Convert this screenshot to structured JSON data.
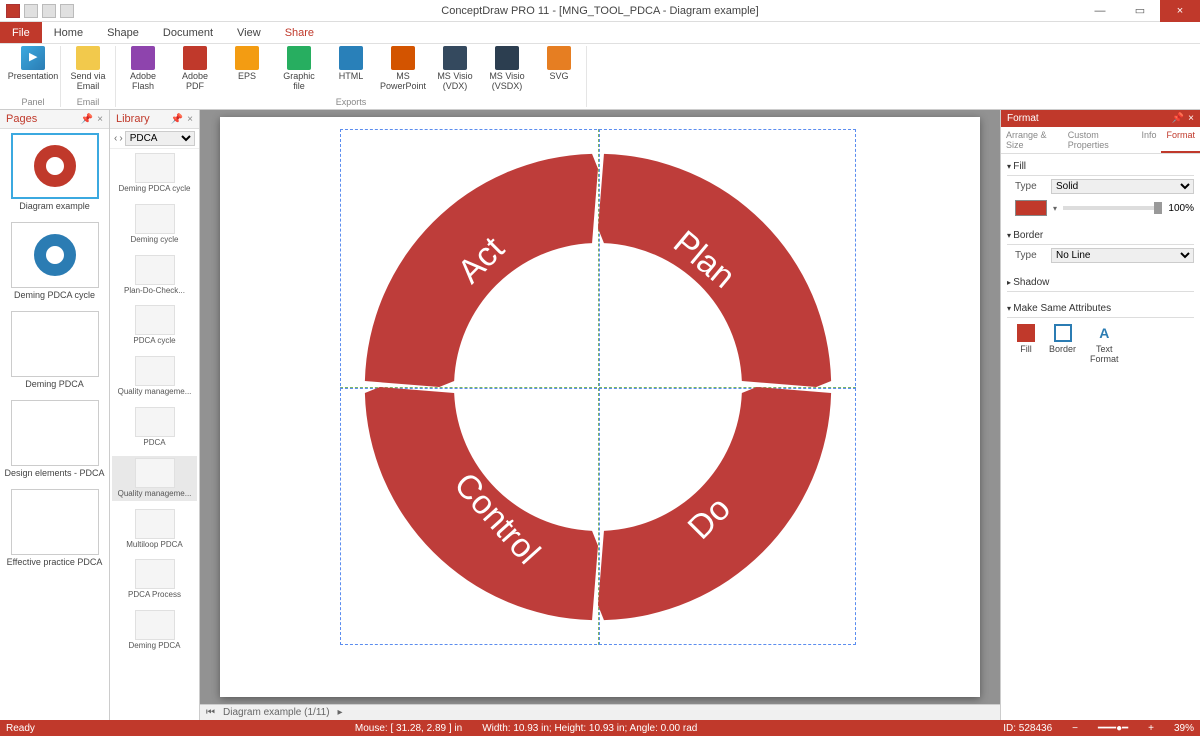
{
  "app": {
    "title": "ConceptDraw PRO 11 - [MNG_TOOL_PDCA - Diagram example]"
  },
  "window": {
    "min": "—",
    "max": "▭",
    "close": "×"
  },
  "tabs": {
    "file": "File",
    "home": "Home",
    "shape": "Shape",
    "document": "Document",
    "view": "View",
    "share": "Share"
  },
  "ribbon": {
    "panel_label": "Panel",
    "email_label": "Email",
    "exports_label": "Exports",
    "presentation": "Presentation",
    "send_email": "Send via\nEmail",
    "flash": "Adobe\nFlash",
    "pdf": "Adobe\nPDF",
    "eps": "EPS",
    "gfx": "Graphic\nfile",
    "html": "HTML",
    "ppt": "MS\nPowerPoint",
    "vdx": "MS Visio\n(VDX)",
    "vsdx": "MS Visio\n(VSDX)",
    "svg": "SVG"
  },
  "pages_panel": {
    "title": "Pages",
    "items": [
      "Diagram example",
      "Deming PDCA cycle",
      "Deming PDCA",
      "Design elements - PDCA",
      "Effective practice PDCA"
    ]
  },
  "library_panel": {
    "title": "Library",
    "dropdown": "PDCA",
    "items": [
      "Deming PDCA cycle",
      "Deming cycle",
      "Plan-Do-Check...",
      "PDCA cycle",
      "Quality manageme...",
      "PDCA",
      "Quality manageme...",
      "Multiloop PDCA",
      "PDCA Process",
      "Deming PDCA"
    ]
  },
  "diagram": {
    "segments": {
      "act": "Act",
      "plan": "Plan",
      "do": "Do",
      "control": "Control"
    },
    "color": "#BE3D3A"
  },
  "canvas_tabs": {
    "label": "Diagram example (1/11)"
  },
  "format_panel": {
    "title": "Format",
    "tabs": {
      "arrange": "Arrange & Size",
      "custom": "Custom Properties",
      "info": "Info",
      "format": "Format"
    },
    "fill": {
      "header": "Fill",
      "type_label": "Type",
      "type_value": "Solid",
      "opacity": "100%"
    },
    "border": {
      "header": "Border",
      "type_label": "Type",
      "type_value": "No Line"
    },
    "shadow": {
      "header": "Shadow"
    },
    "msa": {
      "header": "Make Same Attributes",
      "fill": "Fill",
      "border": "Border",
      "text": "Text\nFormat"
    }
  },
  "status": {
    "ready": "Ready",
    "mouse": "Mouse: [ 31.28, 2.89 ] in",
    "size": "Width: 10.93 in;  Height: 10.93 in;  Angle: 0.00 rad",
    "id": "ID: 528436",
    "zoom": "39%"
  }
}
